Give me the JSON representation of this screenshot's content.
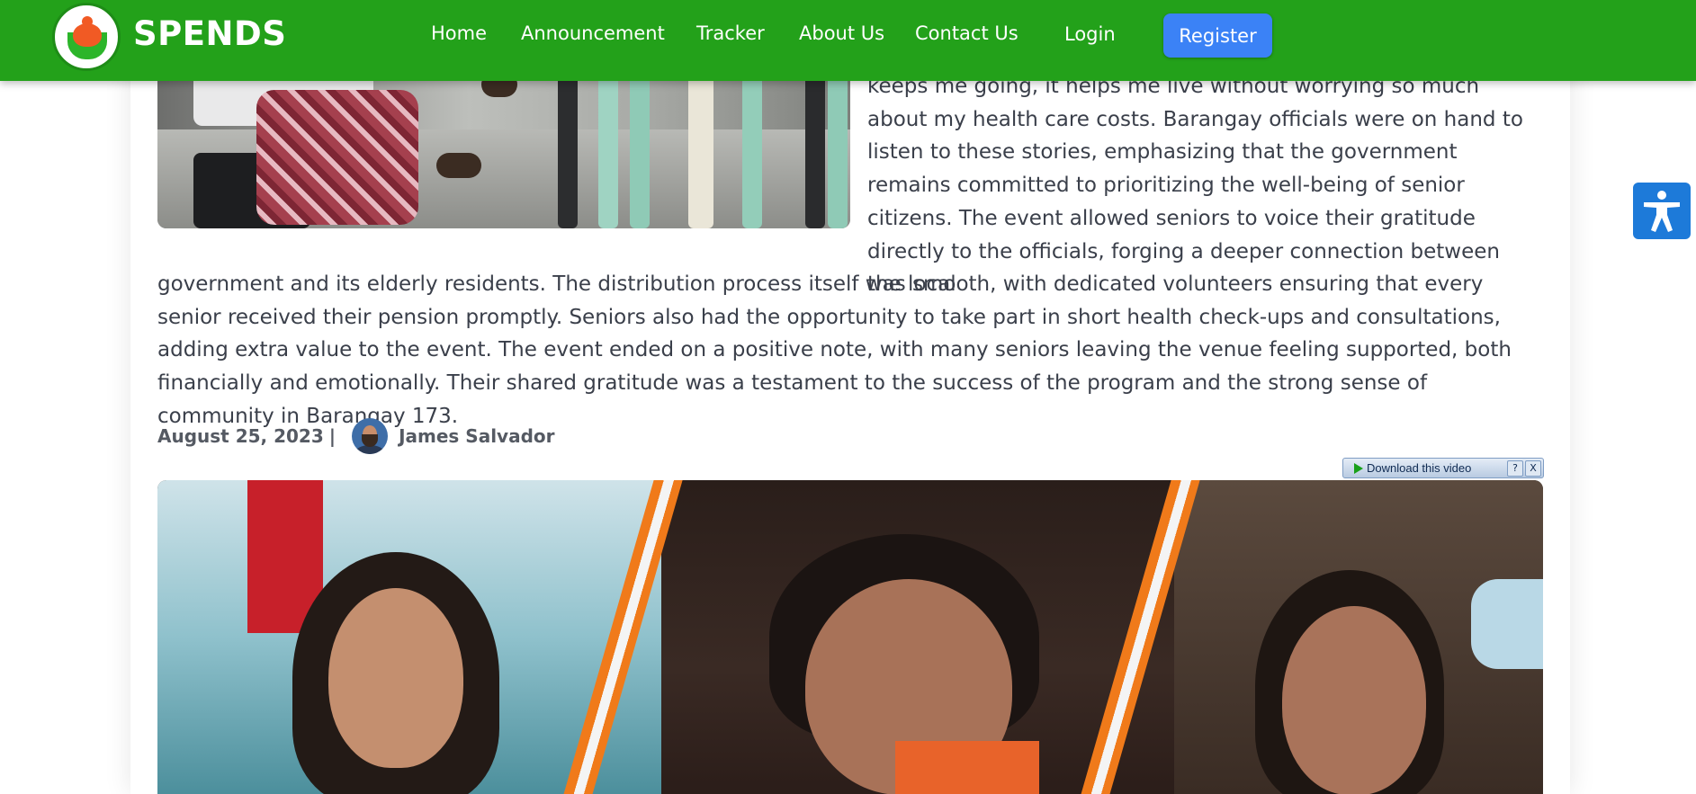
{
  "header": {
    "brand": "SPENDS",
    "nav": [
      "Home",
      "Announcement",
      "Tracker",
      "About Us",
      "Contact Us"
    ],
    "login": "Login",
    "register": "Register",
    "logo_icon": "heart-hands-logo"
  },
  "article": {
    "side_text": "keeps me going, it helps me live without worrying so much about my health care costs. Barangay officials were on hand to listen to these stories, emphasizing that the government remains committed to prioritizing the well-being of senior citizens. The event allowed seniors to voice their gratitude directly to the officials, forging a deeper connection between the local",
    "full_text": "government and its elderly residents. The distribution process itself was smooth, with dedicated volunteers ensuring that every senior received their pension promptly. Seniors also had the opportunity to take part in short health check-ups and consultations, adding extra value to the event. The event ended on a positive note, with many seniors leaving the venue feeling supported, both financially and emotionally. Their shared gratitude was a testament to the success of the program and the strong sense of community in Barangay 173.",
    "date": "August 25, 2023",
    "separator": "|",
    "author": "James Salvador"
  },
  "download_bar": {
    "label": "Download this video",
    "help": "?",
    "close": "X"
  },
  "colors": {
    "header_green": "#23a11a",
    "register_blue": "#3b82f6",
    "accessibility_blue": "#1d7ad9",
    "stripe_orange": "#f07a1a"
  },
  "icons": {
    "accessibility": "accessibility-person-icon"
  }
}
